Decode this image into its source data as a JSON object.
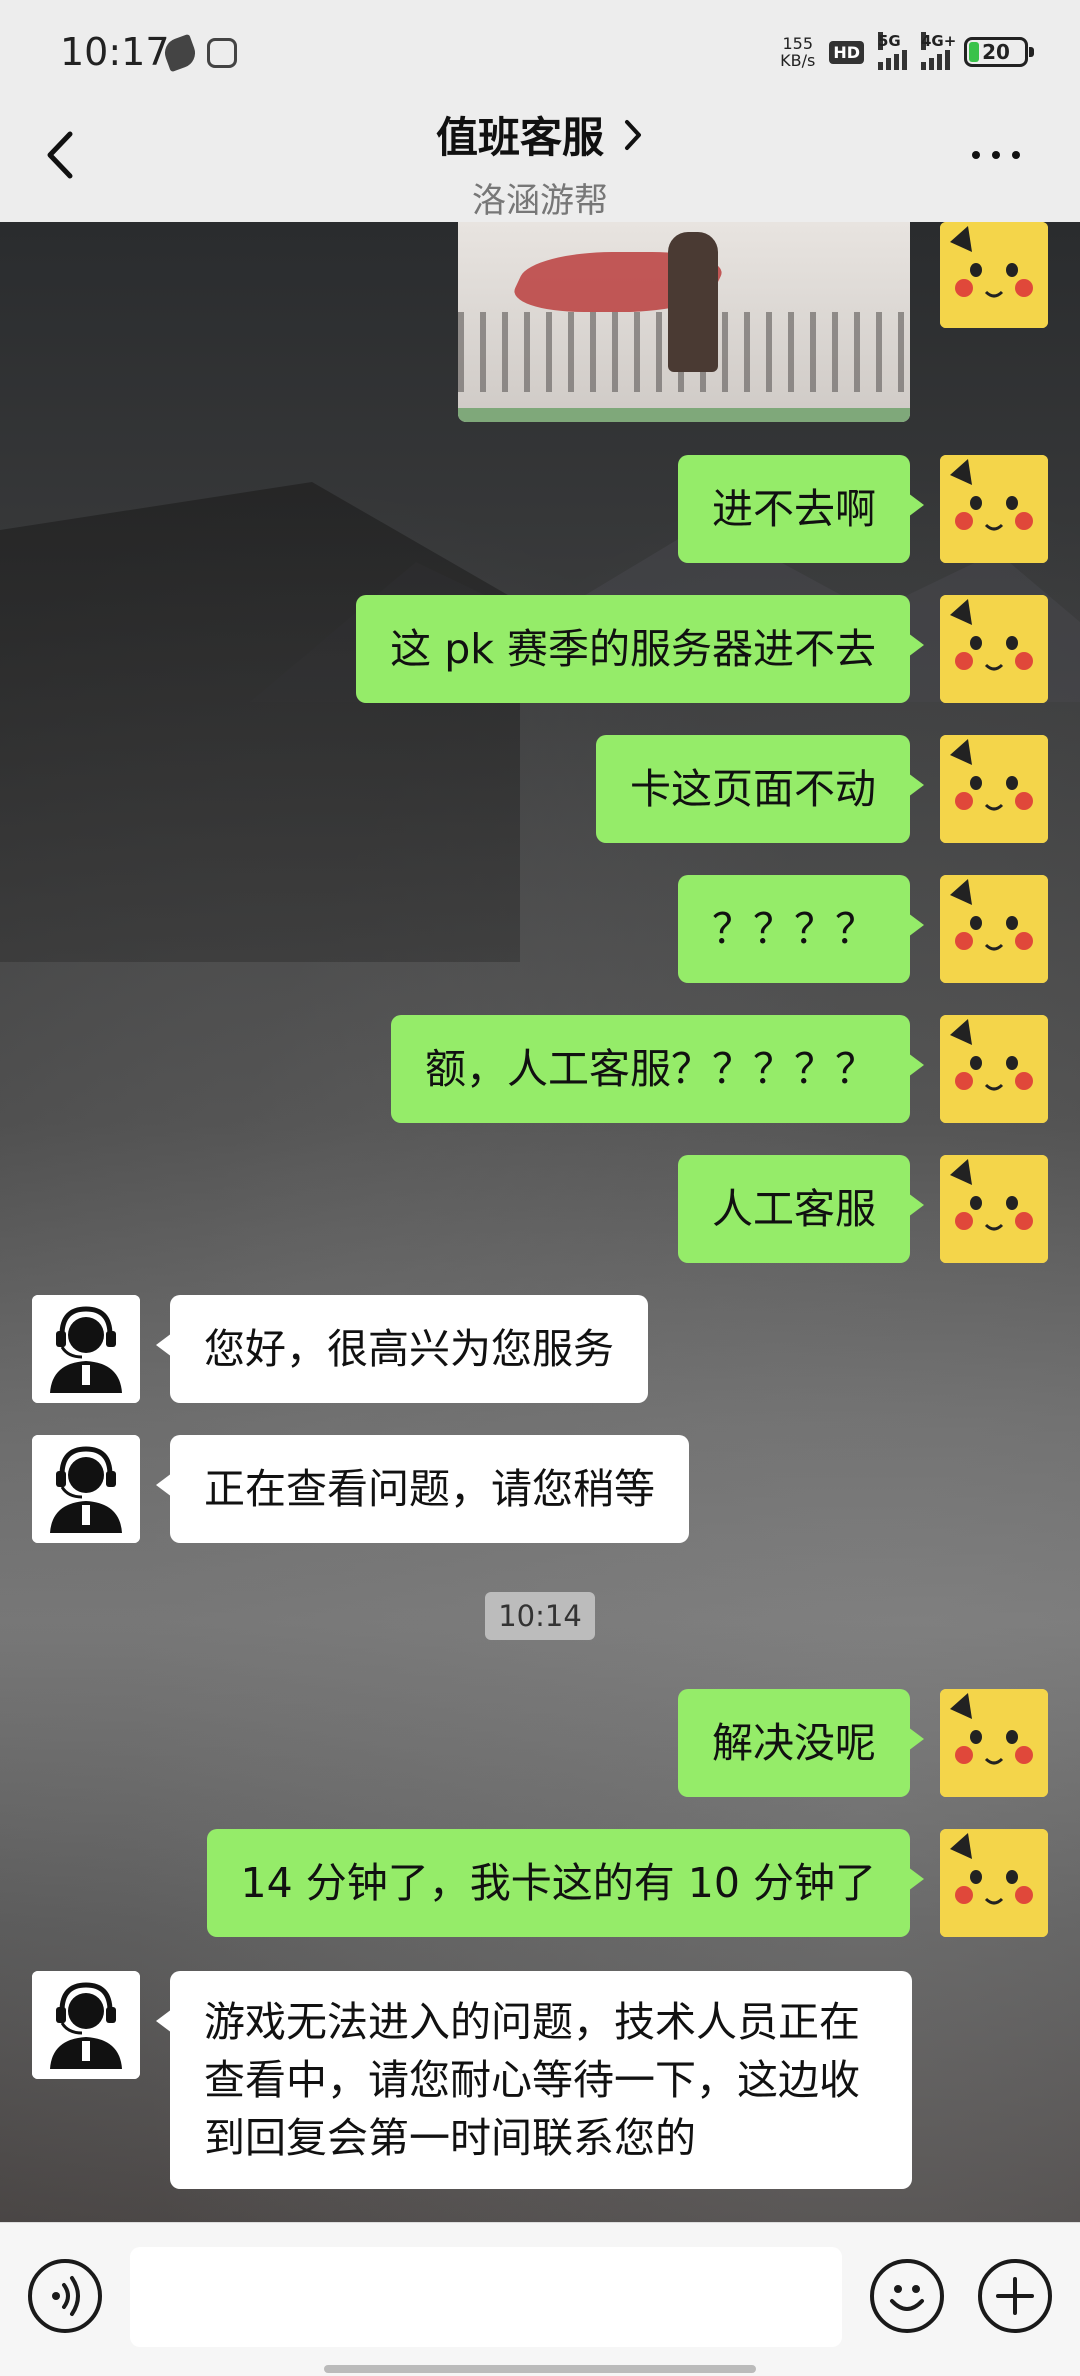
{
  "status_bar": {
    "time": "10:17",
    "net_speed_value": "155",
    "net_speed_unit": "KB/s",
    "hd_label": "HD",
    "sim1_label": "5G",
    "sim2_label": "4G+",
    "battery": "20",
    "battery_color": "#39c24a"
  },
  "header": {
    "title": "值班客服",
    "subtitle": "洛涵游帮",
    "back_icon": "chevron-left-icon",
    "more_icon": "more-dots-icon"
  },
  "colors": {
    "my_bubble": "#95ec69",
    "other_bubble": "#ffffff"
  },
  "messages": [
    {
      "from": "me",
      "type": "image",
      "icon": "game-scene-image"
    },
    {
      "from": "me",
      "text": "进不去啊"
    },
    {
      "from": "me",
      "text": "这 pk 赛季的服务器进不去"
    },
    {
      "from": "me",
      "text": "卡这页面不动"
    },
    {
      "from": "me",
      "text": "？？？？"
    },
    {
      "from": "me",
      "text": "额，人工客服？？？？？"
    },
    {
      "from": "me",
      "text": "人工客服"
    },
    {
      "from": "cs",
      "text": "您好，很高兴为您服务"
    },
    {
      "from": "cs",
      "text": "正在查看问题，请您稍等"
    },
    {
      "type": "timestamp",
      "text": "10:14"
    },
    {
      "from": "me",
      "text": "解决没呢"
    },
    {
      "from": "me",
      "text": "14 分钟了，我卡这的有 10 分钟了"
    },
    {
      "from": "cs",
      "text": "游戏无法进入的问题，技术人员正在查看中，请您耐心等待一下，这边收到回复会第一时间联系您的"
    }
  ],
  "input_bar": {
    "voice_icon": "voice-icon",
    "emoji_icon": "emoji-icon",
    "plus_icon": "plus-icon",
    "input_value": ""
  }
}
